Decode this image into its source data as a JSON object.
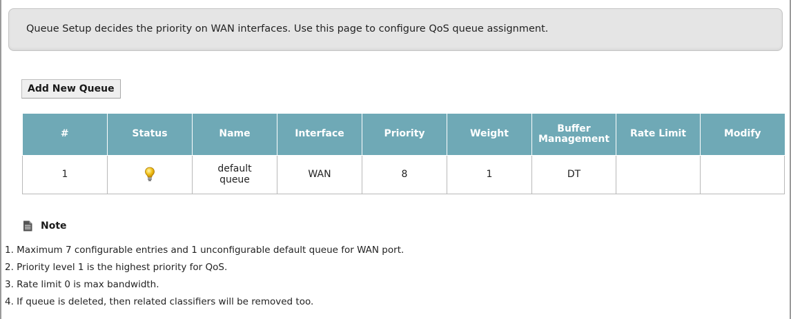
{
  "intro": {
    "text": "Queue Setup decides the priority on WAN interfaces. Use this page to configure QoS queue assignment."
  },
  "toolbar": {
    "add_label": "Add New Queue"
  },
  "table": {
    "headers": [
      "#",
      "Status",
      "Name",
      "Interface",
      "Priority",
      "Weight",
      "Buffer Management",
      "Rate Limit",
      "Modify"
    ],
    "rows": [
      {
        "index": "1",
        "status_icon": "lightbulb-on-icon",
        "name": "default queue",
        "interface": "WAN",
        "priority": "8",
        "weight": "1",
        "buffer_management": "DT",
        "rate_limit": "",
        "modify": ""
      }
    ],
    "header_color": "#6fa9b6",
    "status_color": "#f2c21b"
  },
  "note": {
    "title": "Note",
    "icon": "document-icon",
    "items": [
      "1. Maximum 7 configurable entries and 1 unconfigurable default queue for WAN port.",
      "2. Priority level 1 is the highest priority for QoS.",
      "3. Rate limit 0 is max bandwidth.",
      "4. If queue is deleted, then related classifiers will be removed too."
    ]
  }
}
